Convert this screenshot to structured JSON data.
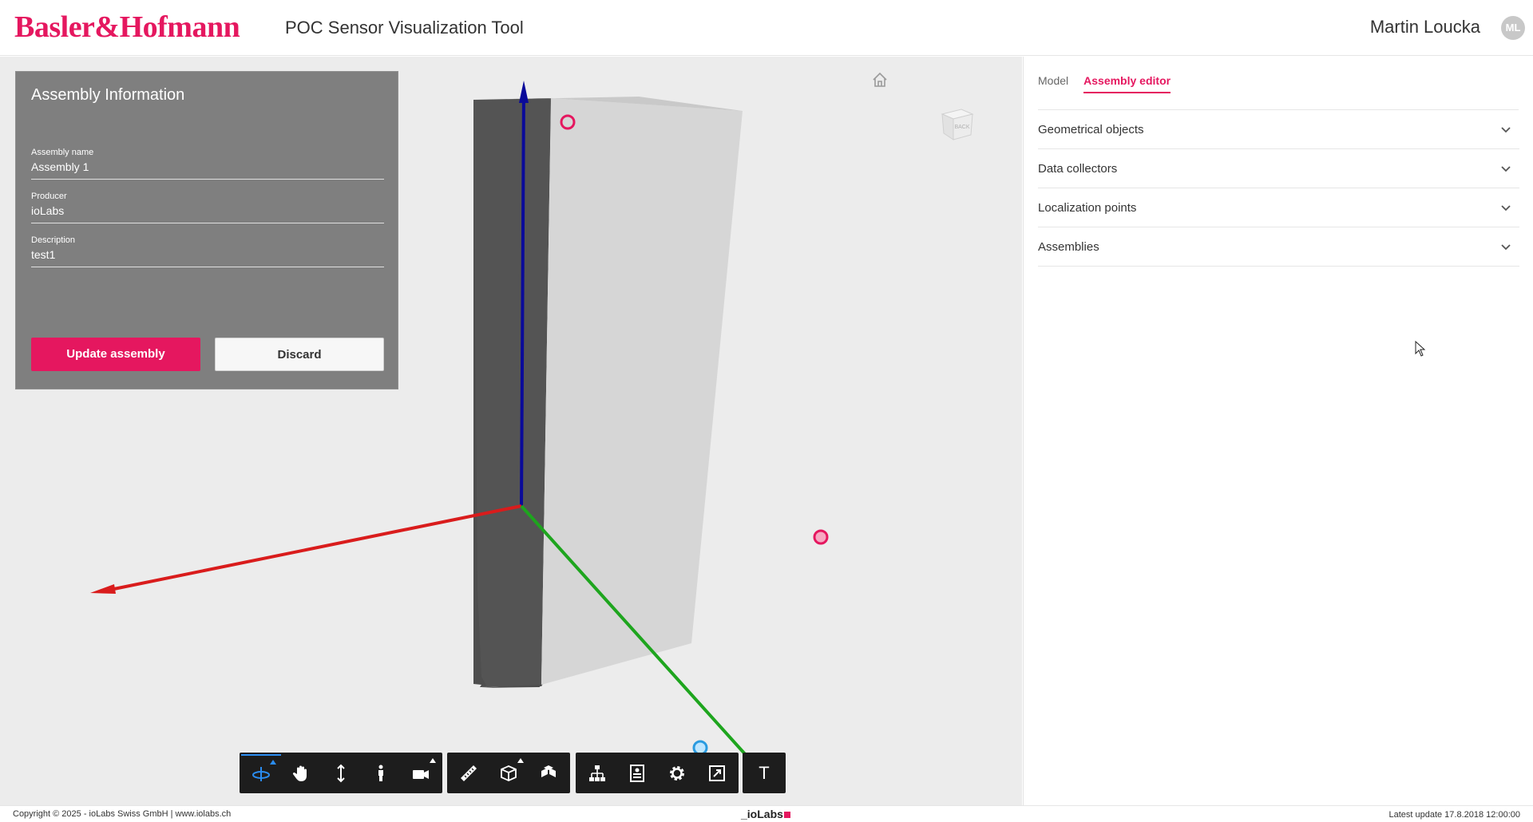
{
  "header": {
    "logo_text": "Basler&Hofmann",
    "app_title": "POC Sensor Visualization Tool",
    "user_name": "Martin Loucka",
    "user_initials": "ML"
  },
  "assembly_panel": {
    "title": "Assembly Information",
    "fields": [
      {
        "label": "Assembly name",
        "value": "Assembly 1"
      },
      {
        "label": "Producer",
        "value": "ioLabs"
      },
      {
        "label": "Description",
        "value": "test1"
      }
    ],
    "update_button": "Update assembly",
    "discard_button": "Discard"
  },
  "viewer": {
    "viewcube_face": "BACK",
    "toolbar": [
      {
        "group": "navigation",
        "tools": [
          "orbit-icon",
          "pan-icon",
          "dolly-icon",
          "first-person-icon",
          "camera-icon"
        ]
      },
      {
        "group": "inspection",
        "tools": [
          "measure-icon",
          "section-icon",
          "explode-icon"
        ]
      },
      {
        "group": "model",
        "tools": [
          "model-browser-icon",
          "properties-icon",
          "settings-icon",
          "fullscreen-icon"
        ]
      },
      {
        "group": "text",
        "tools": [
          "text-icon"
        ],
        "text_tool_label": "T"
      }
    ]
  },
  "sidepanel": {
    "tabs": [
      {
        "label": "Model",
        "active": false
      },
      {
        "label": "Assembly editor",
        "active": true
      }
    ],
    "sections": [
      {
        "label": "Geometrical objects"
      },
      {
        "label": "Data collectors"
      },
      {
        "label": "Localization points"
      },
      {
        "label": "Assemblies"
      }
    ]
  },
  "footer": {
    "copyright": "Copyright © 2025 - ioLabs Swiss GmbH | www.iolabs.ch",
    "brand": "_ioLabs",
    "last_update": "Latest update 17.8.2018 12:00:00"
  },
  "colors": {
    "accent": "#e5175f",
    "x_axis": "#d91c1c",
    "y_axis": "#1ea51e",
    "z_axis": "#0a0a9a",
    "toolbar_bg": "#1d1d1d",
    "active_tool": "#2a8cf0"
  }
}
